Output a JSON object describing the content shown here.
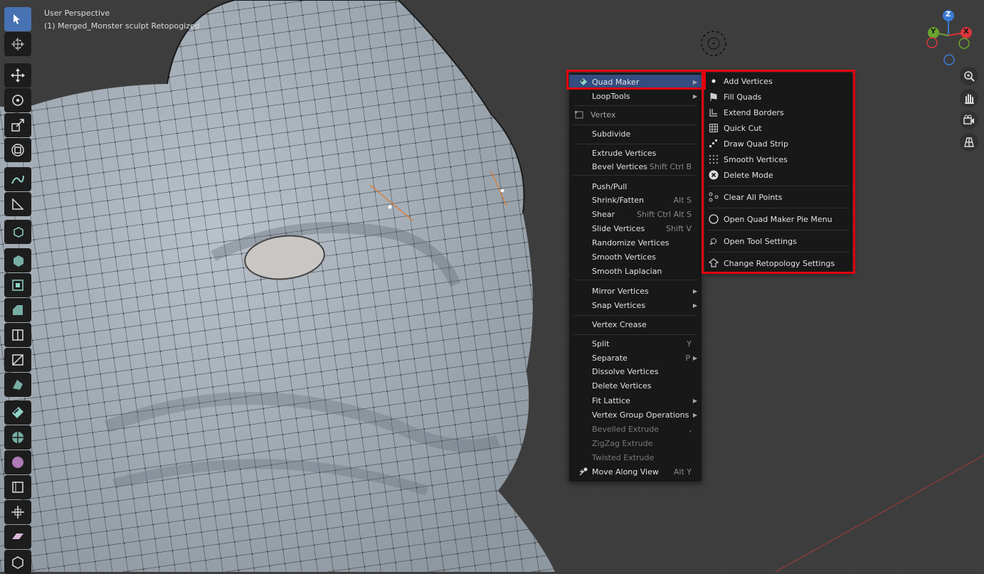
{
  "viewport": {
    "perspective_label": "User Perspective",
    "object_label": "(1) Merged_Monster sculpt Retopogized"
  },
  "toolbar": {
    "tools": [
      {
        "name": "select-box-tool-icon",
        "active": true
      },
      {
        "name": "cursor-tool-icon",
        "active": false
      },
      {
        "name": "move-tool-icon",
        "active": false
      },
      {
        "name": "rotate-tool-icon",
        "active": false
      },
      {
        "name": "scale-tool-icon",
        "active": false
      },
      {
        "name": "transform-tool-icon",
        "active": false
      },
      {
        "name": "annotate-tool-icon",
        "active": false
      },
      {
        "name": "measure-tool-icon",
        "active": false
      },
      {
        "name": "add-cube-tool-icon",
        "active": false
      },
      {
        "name": "extrude-region-tool-icon",
        "active": false
      },
      {
        "name": "inset-faces-tool-icon",
        "active": false
      },
      {
        "name": "bevel-tool-icon",
        "active": false
      },
      {
        "name": "loop-cut-tool-icon",
        "active": false
      },
      {
        "name": "knife-tool-icon",
        "active": false
      },
      {
        "name": "poly-build-tool-icon",
        "active": false
      },
      {
        "name": "quad-maker-tool-icon",
        "active": false
      },
      {
        "name": "spin-tool-icon",
        "active": false
      },
      {
        "name": "smooth-tool-icon",
        "active": false
      },
      {
        "name": "edge-slide-tool-icon",
        "active": false
      },
      {
        "name": "shrink-fatten-tool-icon",
        "active": false
      },
      {
        "name": "shear-tool-icon",
        "active": false
      },
      {
        "name": "rip-region-tool-icon",
        "active": false
      }
    ]
  },
  "gizmo": {
    "z_label": "Z",
    "y_label": "Y",
    "x_label": "X"
  },
  "nav_buttons": [
    "zoom-icon",
    "pan-hand-icon",
    "camera-icon",
    "grid-view-icon"
  ],
  "main_menu": {
    "items": [
      {
        "label": "Quad Maker",
        "submenu": true,
        "highlight": true
      },
      {
        "label": "LoopTools",
        "submenu": true
      },
      {
        "label": "Vertex",
        "header": true
      },
      {
        "label": "Subdivide"
      },
      {
        "label": "Extrude Vertices"
      },
      {
        "label": "Bevel Vertices",
        "shortcut": "Shift Ctrl B"
      },
      {
        "label": "Push/Pull"
      },
      {
        "label": "Shrink/Fatten",
        "shortcut": "Alt S"
      },
      {
        "label": "Shear",
        "shortcut": "Shift Ctrl Alt S"
      },
      {
        "label": "Slide Vertices",
        "shortcut": "Shift V"
      },
      {
        "label": "Randomize Vertices"
      },
      {
        "label": "Smooth Vertices"
      },
      {
        "label": "Smooth Laplacian"
      },
      {
        "label": "Mirror Vertices",
        "submenu": true
      },
      {
        "label": "Snap Vertices",
        "submenu": true
      },
      {
        "label": "Vertex Crease"
      },
      {
        "label": "Split",
        "shortcut": "Y"
      },
      {
        "label": "Separate",
        "shortcut": "P"
      },
      {
        "label": "Dissolve Vertices"
      },
      {
        "label": "Delete Vertices"
      },
      {
        "label": "Fit Lattice",
        "submenu": true
      },
      {
        "label": "Vertex Group Operations",
        "submenu": true
      },
      {
        "label": "Bevelled Extrude",
        "disabled": true,
        "shortcut": ","
      },
      {
        "label": "ZigZag Extrude",
        "disabled": true
      },
      {
        "label": "Twisted Extrude",
        "disabled": true
      },
      {
        "label": "Move Along View",
        "shortcut": "Alt Y"
      }
    ]
  },
  "sub_menu": {
    "items": [
      {
        "label": "Add Vertices",
        "icon": "dot-icon"
      },
      {
        "label": "Fill Quads",
        "icon": "fill-quads-icon"
      },
      {
        "label": "Extend Borders",
        "icon": "extend-borders-icon"
      },
      {
        "label": "Quick Cut",
        "icon": "quick-cut-icon"
      },
      {
        "label": "Draw Quad Strip",
        "icon": "quad-strip-icon"
      },
      {
        "label": "Smooth Vertices",
        "icon": "smooth-dots-icon"
      },
      {
        "label": "Delete Mode",
        "icon": "delete-x-icon"
      },
      {
        "label": "Clear All Points",
        "icon": "clear-points-icon"
      },
      {
        "label": "Open Quad Maker Pie Menu",
        "icon": "circle-icon"
      },
      {
        "label": "Open Tool Settings",
        "icon": "tool-settings-icon"
      },
      {
        "label": "Change Retopology Settings",
        "icon": "retopology-settings-icon"
      }
    ]
  },
  "colors": {
    "highlight_box": "#e3000f",
    "menu_bg": "#181818",
    "active_tool": "#4772b3",
    "mesh_fill": "#a8b1ba"
  }
}
